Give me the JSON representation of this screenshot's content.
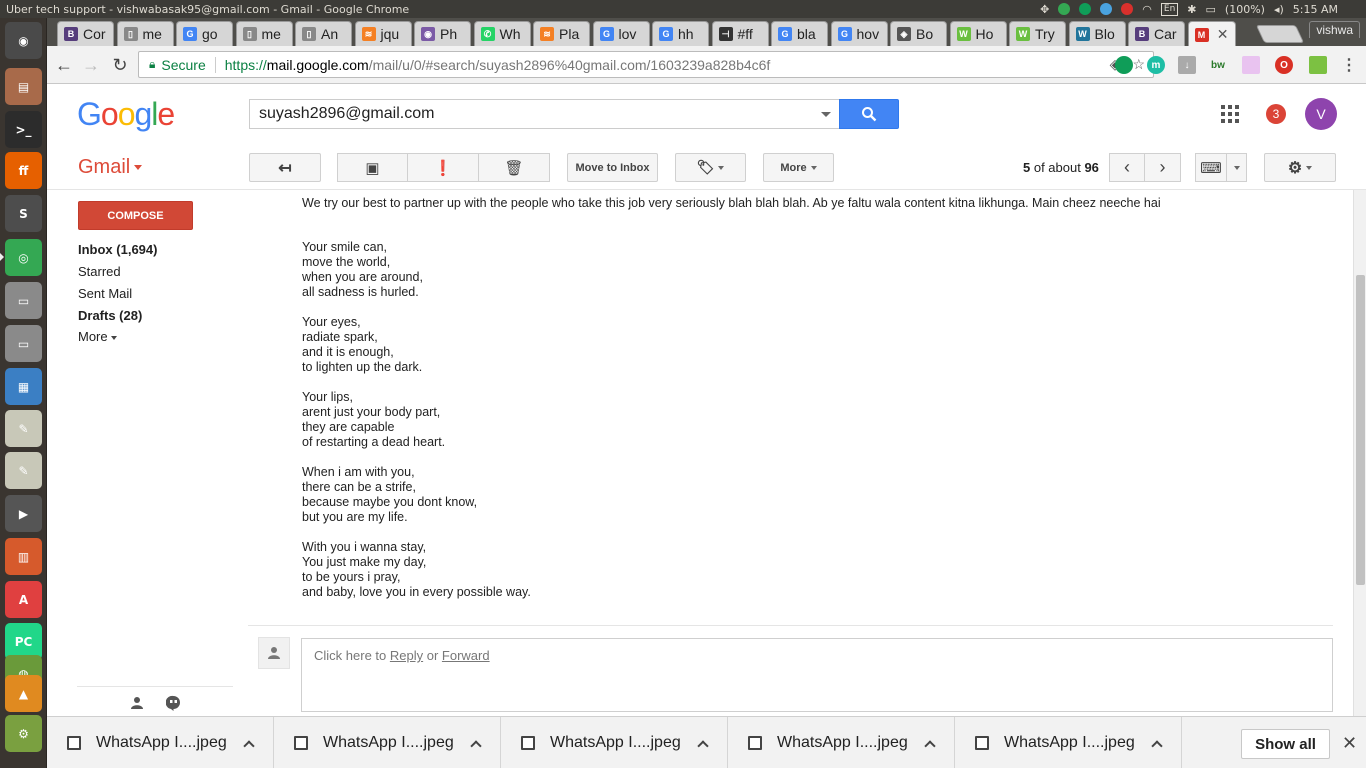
{
  "os_panel": {
    "window_title": "Uber tech support - vishwabasak95@gmail.com - Gmail - Google Chrome",
    "lang_indicator": "En",
    "battery": "(100%)",
    "clock": "5:15 AM"
  },
  "launcher": [
    {
      "name": "ubuntu-dash-icon",
      "color": "#4a4a4a",
      "glyph": "◉"
    },
    {
      "name": "files-icon",
      "color": "#a86a4a",
      "glyph": "▤"
    },
    {
      "name": "terminal-icon",
      "color": "#2c2c2c",
      "glyph": ">_"
    },
    {
      "name": "firefox-icon",
      "color": "#e66000",
      "glyph": "ff"
    },
    {
      "name": "sublime-text-icon",
      "color": "#4d4d4d",
      "glyph": "S"
    },
    {
      "name": "chrome-icon",
      "color": "#34a853",
      "glyph": "◎"
    },
    {
      "name": "disk-icon",
      "color": "#8a8a8a",
      "glyph": "▭"
    },
    {
      "name": "disk-icon-2",
      "color": "#8a8a8a",
      "glyph": "▭"
    },
    {
      "name": "document-viewer-icon",
      "color": "#3b7fc4",
      "glyph": "▦"
    },
    {
      "name": "text-editor-icon",
      "color": "#c8c8b8",
      "glyph": "✎"
    },
    {
      "name": "text-editor-icon-2",
      "color": "#c8c8b8",
      "glyph": "✎"
    },
    {
      "name": "video-editor-icon",
      "color": "#555555",
      "glyph": "▶"
    },
    {
      "name": "impress-icon",
      "color": "#d65a2c",
      "glyph": "▥"
    },
    {
      "name": "pdf-viewer-icon",
      "color": "#e04040",
      "glyph": "A"
    },
    {
      "name": "pycharm-icon",
      "color": "#21d789",
      "glyph": "PC"
    },
    {
      "name": "android-studio-icon",
      "color": "#6a9a3a",
      "glyph": "◍"
    },
    {
      "name": "vlc-icon",
      "color": "#e08a20",
      "glyph": "▲"
    },
    {
      "name": "system-settings-icon",
      "color": "#7aa040",
      "glyph": "⚙"
    }
  ],
  "tabs": [
    {
      "label": "Cor",
      "fav": "B",
      "fav_color": "#563d7c"
    },
    {
      "label": "me",
      "fav": "▯",
      "fav_color": "#888888"
    },
    {
      "label": "go",
      "fav": "G",
      "fav_color": "#4285f4"
    },
    {
      "label": "me",
      "fav": "▯",
      "fav_color": "#888888"
    },
    {
      "label": "An",
      "fav": "▯",
      "fav_color": "#888888"
    },
    {
      "label": "jqu",
      "fav": "≋",
      "fav_color": "#f48024"
    },
    {
      "label": "Ph",
      "fav": "◉",
      "fav_color": "#7b5aa6"
    },
    {
      "label": "Wh",
      "fav": "✆",
      "fav_color": "#25d366"
    },
    {
      "label": "Pla",
      "fav": "≋",
      "fav_color": "#f48024"
    },
    {
      "label": "lov",
      "fav": "G",
      "fav_color": "#4285f4"
    },
    {
      "label": "hh",
      "fav": "G",
      "fav_color": "#4285f4"
    },
    {
      "label": "#ff",
      "fav": "⊣",
      "fav_color": "#333333"
    },
    {
      "label": "bla",
      "fav": "G",
      "fav_color": "#4285f4"
    },
    {
      "label": "hov",
      "fav": "G",
      "fav_color": "#4285f4"
    },
    {
      "label": "Bo",
      "fav": "◈",
      "fav_color": "#555555"
    },
    {
      "label": "Ho",
      "fav": "W",
      "fav_color": "#6abf40"
    },
    {
      "label": "Try",
      "fav": "W",
      "fav_color": "#6abf40"
    },
    {
      "label": "Blo",
      "fav": "W",
      "fav_color": "#21759b"
    },
    {
      "label": "Car",
      "fav": "B",
      "fav_color": "#563d7c"
    },
    {
      "label": "",
      "fav": "M",
      "fav_color": "#d93025",
      "active": true
    }
  ],
  "profile_user": "vishwa",
  "address_bar": {
    "secure_label": "Secure",
    "url_scheme": "https://",
    "url_host": "mail.google.com",
    "url_path": "/mail/u/0/#search/suyash2896%40gmail.com/1603239a828b4c6f"
  },
  "header": {
    "search_value": "suyash2896@gmail.com",
    "notification_count": "3",
    "avatar_letter": "V"
  },
  "action_bar": {
    "gmail_label": "Gmail",
    "move_to_inbox": "Move to Inbox",
    "more": "More",
    "pager_current": "5",
    "pager_of_about": " of about ",
    "pager_total": "96"
  },
  "left_nav": {
    "compose": "COMPOSE",
    "inbox": "Inbox (1,694)",
    "starred": "Starred",
    "sent": "Sent Mail",
    "drafts": "Drafts (28)",
    "more": "More"
  },
  "message": {
    "partial_line": "",
    "intro": "We try our best to partner up with the people who take this job very seriously blah blah blah. Ab ye faltu wala content kitna likhunga. Main cheez neeche hai",
    "stanzas": [
      [
        "Your smile can,",
        "move the world,",
        "when you are around,",
        "all sadness is hurled."
      ],
      [
        "Your eyes,",
        "radiate spark,",
        "and it is enough,",
        "to lighten up the dark."
      ],
      [
        "Your lips,",
        "arent just your body part,",
        "they are capable",
        "of restarting a dead heart."
      ],
      [
        "When i am with you,",
        "there can be a strife,",
        "because maybe you dont know,",
        "but you are my life."
      ],
      [
        "With you i wanna stay,",
        "You just make my day,",
        "to be yours i pray,",
        "and baby, love you in every possible way."
      ]
    ]
  },
  "reply": {
    "prefix": "Click here to ",
    "reply_link": "Reply",
    "or": " or ",
    "forward_link": "Forward"
  },
  "downloads": [
    {
      "name": "WhatsApp I....jpeg"
    },
    {
      "name": "WhatsApp I....jpeg"
    },
    {
      "name": "WhatsApp I....jpeg"
    },
    {
      "name": "WhatsApp I....jpeg"
    },
    {
      "name": "WhatsApp I....jpeg"
    }
  ],
  "show_all": "Show all",
  "colors": {
    "gmail_red": "#dd4b39",
    "compose_red": "#d14836",
    "search_blue": "#4285f4",
    "secure_green": "#0b8043"
  }
}
